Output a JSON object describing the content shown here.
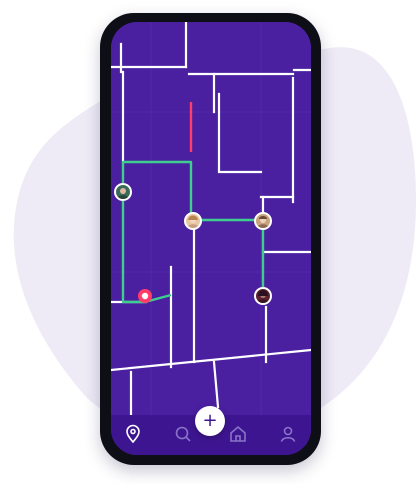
{
  "colors": {
    "background_blob": "#eeebf6",
    "map_background": "#4a1fa0",
    "road": "#ffffff",
    "route": "#3ecf8e",
    "alert_segment": "#ff3d68",
    "location_pin": "#ff3d68",
    "tab_bar": "#3e1590",
    "tab_active": "#ffffff",
    "tab_inactive": "#8a74c8"
  },
  "avatars": [
    {
      "name": "avatar-left",
      "tone": "#3a6b5a"
    },
    {
      "name": "avatar-center",
      "tone": "#e8c7a4"
    },
    {
      "name": "avatar-right",
      "tone": "#c9a27e"
    },
    {
      "name": "avatar-bottom",
      "tone": "#5a2230"
    }
  ],
  "fab": {
    "label": "+"
  },
  "tabbar": {
    "active": "location",
    "items": [
      {
        "icon": "location-pin-icon"
      },
      {
        "icon": "search-icon"
      },
      {
        "icon": "home-icon"
      },
      {
        "icon": "profile-icon"
      }
    ]
  }
}
